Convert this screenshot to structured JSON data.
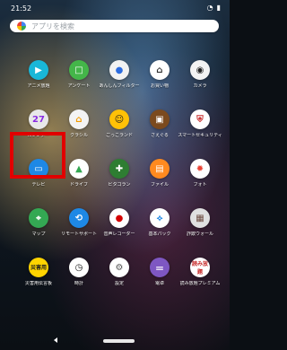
{
  "status_bar": {
    "time": "21:52",
    "icons": [
      "wifi-icon",
      "battery-icon"
    ]
  },
  "search": {
    "placeholder": "アプリを検索"
  },
  "apps": [
    {
      "label": "アニメ放題",
      "icon": "anime-houdai-icon",
      "color": "#19b7d8"
    },
    {
      "label": "アンケート",
      "icon": "survey-icon",
      "color": "#44b649"
    },
    {
      "label": "あんしんフィルター",
      "icon": "safe-filter-icon",
      "color": "#f2f2f2"
    },
    {
      "label": "お買い物",
      "icon": "shopping-icon",
      "color": "#ffffff"
    },
    {
      "label": "カメラ",
      "icon": "camera-icon",
      "color": "#f3f3f3"
    },
    {
      "label": "カレンダー",
      "icon": "calendar-icon",
      "color": "#e8e8e8",
      "text": "27"
    },
    {
      "label": "クラシル",
      "icon": "kurashiru-icon",
      "color": "#f3f3f3"
    },
    {
      "label": "ごっこランド",
      "icon": "gokko-land-icon",
      "color": "#ffc107"
    },
    {
      "label": "さえぐる",
      "icon": "saeguru-icon",
      "color": "#7b4a1e"
    },
    {
      "label": "スマートセキュリティ",
      "icon": "smart-security-icon",
      "color": "#ffffff"
    },
    {
      "label": "テレビ",
      "icon": "tv-icon",
      "color": "#1e88e5"
    },
    {
      "label": "ドライブ",
      "icon": "google-drive-icon",
      "color": "#ffffff"
    },
    {
      "label": "ビタゴラン",
      "icon": "vitagoran-icon",
      "color": "#2e7d32"
    },
    {
      "label": "ファイル",
      "icon": "files-icon",
      "color": "#ff8a1f"
    },
    {
      "label": "フォト",
      "icon": "photos-icon",
      "color": "#ffffff"
    },
    {
      "label": "マップ",
      "icon": "maps-icon",
      "color": "#34a853"
    },
    {
      "label": "リモートサポート",
      "icon": "remote-support-icon",
      "color": "#1e88e5"
    },
    {
      "label": "音声レコーダー",
      "icon": "voice-recorder-icon",
      "color": "#ffffff"
    },
    {
      "label": "基本パック",
      "icon": "basic-pack-icon",
      "color": "#ffffff"
    },
    {
      "label": "詐欺ウォール",
      "icon": "fraud-wall-icon",
      "color": "#e0e0e0"
    },
    {
      "label": "災害用伝言板",
      "icon": "disaster-board-icon",
      "color": "#ffd400",
      "text": "災害用"
    },
    {
      "label": "時計",
      "icon": "clock-icon",
      "color": "#ffffff"
    },
    {
      "label": "設定",
      "icon": "settings-icon",
      "color": "#ffffff"
    },
    {
      "label": "電卓",
      "icon": "calculator-icon",
      "color": "#7e57c2"
    },
    {
      "label": "読み放題プレミアム",
      "icon": "reading-premium-icon",
      "color": "#ffffff",
      "text": "読み放題"
    }
  ],
  "highlight": {
    "target_label": "テレビ",
    "color": "#e10000"
  },
  "navigation": {
    "back": "back-icon",
    "home": "home-pill"
  }
}
